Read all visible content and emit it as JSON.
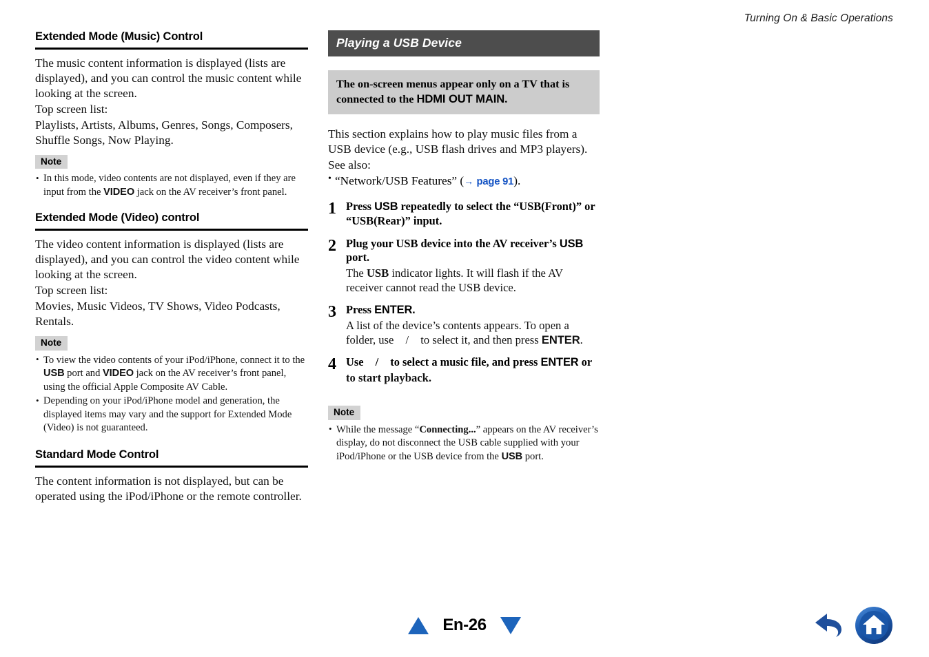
{
  "header": {
    "running_title": "Turning On & Basic Operations"
  },
  "left_column": {
    "sections": [
      {
        "heading": "Extended Mode (Music) Control",
        "paragraphs": [
          "The music content information is displayed (lists are displayed), and you can control the music content while looking at the screen.",
          "Top screen list:",
          "Playlists, Artists, Albums, Genres, Songs, Composers, Shuffle Songs, Now Playing."
        ],
        "note_label": "Note",
        "notes": [
          {
            "pre": "In this mode, video contents are not displayed, even if they are input from the ",
            "bold": "VIDEO",
            "post": " jack on the AV receiver’s front panel."
          }
        ]
      },
      {
        "heading": "Extended Mode (Video) control",
        "paragraphs": [
          "The video content information is displayed (lists are displayed), and you can control the video content while looking at the screen.",
          "Top screen list:",
          "Movies, Music Videos, TV Shows, Video Podcasts, Rentals."
        ],
        "note_label": "Note",
        "notes": [
          {
            "pre": "To view the video contents of your iPod/iPhone, connect it to the ",
            "bold": "USB",
            "mid": " port and ",
            "bold2": "VIDEO",
            "post": " jack on the AV receiver’s front panel, using the official Apple Composite AV Cable."
          },
          {
            "plain": "Depending on your iPod/iPhone model and generation, the displayed items may vary and the support for Extended Mode (Video) is not guaranteed."
          }
        ]
      },
      {
        "heading": "Standard Mode Control",
        "paragraphs": [
          "The content information is not displayed, but can be operated using the iPod/iPhone or the remote controller."
        ]
      }
    ]
  },
  "right_column": {
    "title": "Playing a USB Device",
    "callout": {
      "text_before": "The on-screen menus appear only on a TV that is connected to the ",
      "emphasis": "HDMI OUT MAIN",
      "text_after": "."
    },
    "intro": "This section explains how to play music files from a USB device (e.g., USB flash drives and MP3 players).",
    "see_also_label": "See also:",
    "see_also": {
      "prefix": "“Network/USB Features” (",
      "arrow": "→",
      "link": "page 91",
      "suffix": ").",
      "link_color": "#1554c4"
    },
    "steps": [
      {
        "num": "1",
        "lead_parts": [
          {
            "t": "Press ",
            "s": "serif-bold"
          },
          {
            "t": "USB",
            "s": "sans-bold"
          },
          {
            "t": " repeatedly to select the “USB(Front)” or “USB(Rear)” input.",
            "s": "serif-bold"
          }
        ],
        "sub_parts": []
      },
      {
        "num": "2",
        "lead_parts": [
          {
            "t": "Plug your USB device into the AV receiver’s ",
            "s": "serif-bold"
          },
          {
            "t": "USB",
            "s": "sans-bold"
          },
          {
            "t": " port.",
            "s": "serif-bold"
          }
        ],
        "sub_parts": [
          {
            "t": "The ",
            "s": "serif"
          },
          {
            "t": "USB",
            "s": "serif-bold"
          },
          {
            "t": " indicator lights. It will flash if the AV receiver cannot read the USB device.",
            "s": "serif"
          }
        ]
      },
      {
        "num": "3",
        "lead_parts": [
          {
            "t": "Press ",
            "s": "serif-bold"
          },
          {
            "t": "ENTER.",
            "s": "sans-bold"
          }
        ],
        "sub_parts": [
          {
            "t": "A list of the device’s contents appears. To open a folder, use ",
            "s": "serif"
          },
          {
            "t": "",
            "s": "keygap"
          },
          {
            "t": "/",
            "s": "serif"
          },
          {
            "t": "",
            "s": "keygap"
          },
          {
            "t": " to select it, and then press ",
            "s": "serif"
          },
          {
            "t": "ENTER",
            "s": "sans-bold"
          },
          {
            "t": ".",
            "s": "serif"
          }
        ]
      },
      {
        "num": "4",
        "lead_parts": [
          {
            "t": "Use ",
            "s": "serif-bold"
          },
          {
            "t": "",
            "s": "keygap"
          },
          {
            "t": "/",
            "s": "serif-bold"
          },
          {
            "t": "",
            "s": "keygap"
          },
          {
            "t": " to select a music file, and press ",
            "s": "serif-bold"
          },
          {
            "t": "ENTER",
            "s": "sans-bold"
          },
          {
            "t": " or",
            "s": "serif-bold"
          }
        ],
        "sub_parts": [
          {
            "t": "      to start playback.",
            "s": "serif-bold"
          }
        ]
      }
    ],
    "note_label": "Note",
    "notes": [
      {
        "pre": "While the message “",
        "bold": "Connecting...",
        "mid": "” appears on the AV receiver’s display, do not disconnect the USB cable supplied with your iPod/iPhone or the USB device from the ",
        "bold2": "USB",
        "post": " port."
      }
    ]
  },
  "footer": {
    "page_label": "En-26",
    "prev_icon": "triangle-up-icon",
    "next_icon": "triangle-down-icon",
    "back_icon": "back-arrow-icon",
    "home_icon": "home-icon",
    "accent_color": "#1d64bb"
  }
}
